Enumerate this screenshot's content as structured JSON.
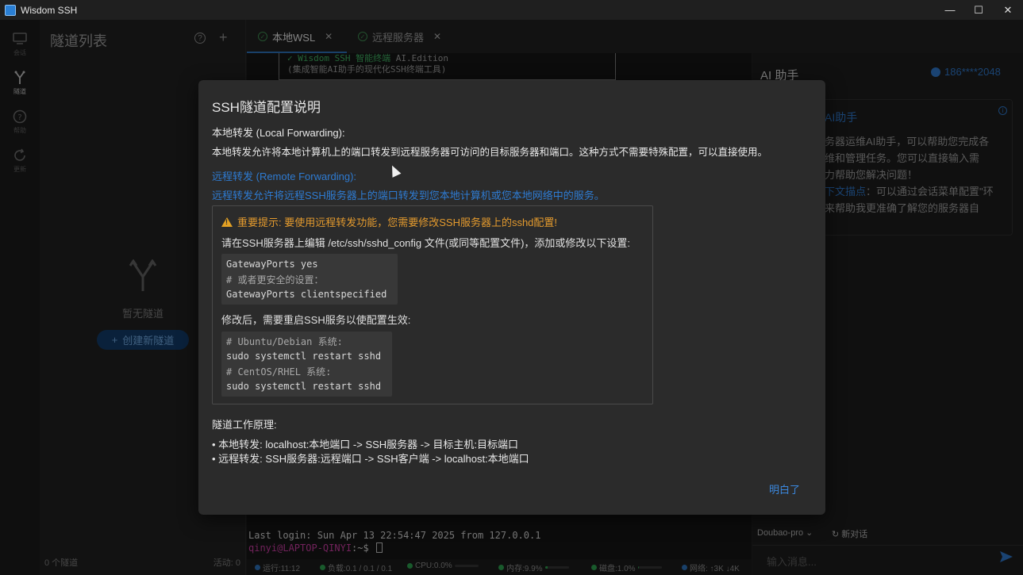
{
  "window": {
    "title": "Wisdom SSH",
    "minimize": "—",
    "maximize": "☐",
    "close": "✕"
  },
  "rail": {
    "items": [
      {
        "label": "会话",
        "icon": "monitor-icon"
      },
      {
        "label": "隧道",
        "icon": "fork-icon"
      },
      {
        "label": "帮助",
        "icon": "help-icon"
      },
      {
        "label": "更新",
        "icon": "refresh-icon"
      }
    ]
  },
  "tunnel_panel": {
    "title": "隧道列表",
    "help": "?",
    "add": "+",
    "empty_text": "暂无隧道",
    "create_button": "创建新隧道",
    "create_plus": "+",
    "count": "0 个隧道",
    "active": "活动: 0"
  },
  "tabs": [
    {
      "label": "本地WSL",
      "close": "✕",
      "active": true
    },
    {
      "label": "远程服务器",
      "close": "✕",
      "active": false
    }
  ],
  "terminal": {
    "banner_line1_prefix": "✓ Wisdom SSH 智能终端",
    "banner_line1_suffix": " AI.Edition",
    "banner_line2": "(集成智能AI助手的现代化SSH终端工具)",
    "last_login": "Last login: Sun Apr 13 22:54:47 2025 from 127.0.0.1",
    "prompt_user": "qinyi@LAPTOP-QINYI",
    "prompt_path": ":~$ "
  },
  "statusbar": {
    "runtime": "运行:11:12",
    "load": "负载:0.1 / 0.1 / 0.1",
    "cpu": "CPU:0.0%",
    "mem": "内存:9.9%",
    "disk": "磁盘:1.0%",
    "net": "网络: ↑3K ↓4K",
    "mem_level": 0.099,
    "disk_level": 0.01,
    "cpu_level": 0.0
  },
  "ai_panel": {
    "title": "AI 助手",
    "user": "186****2048",
    "card_heading": "AI助手",
    "card_line1": "务器运维AI助手，可以帮助您完成各",
    "card_line2": "维和管理任务。您可以直接输入需",
    "card_line3": "力帮助您解决问题！",
    "card_line4_hl": "下文描点",
    "card_line4_rest": "：可以通过会话菜单配置\"环",
    "card_line5": "来帮助我更准确了解您的服务器自",
    "model": "Doubao-pro",
    "new_chat": "新对话",
    "input_placeholder": "输入消息..."
  },
  "modal": {
    "title": "SSH隧道配置说明",
    "local_heading": "本地转发 (Local Forwarding):",
    "local_desc": "本地转发允许将本地计算机上的端口转发到远程服务器可访问的目标服务器和端口。这种方式不需要特殊配置，可以直接使用。",
    "remote_heading": "远程转发 (Remote Forwarding):",
    "remote_desc": "远程转发允许将远程SSH服务器上的端口转发到您本地计算机或您本地网络中的服务。",
    "warning": "重要提示: 要使用远程转发功能，您需要修改SSH服务器上的sshd配置!",
    "edit_instruction": "请在SSH服务器上编辑 /etc/ssh/sshd_config 文件(或同等配置文件)，添加或修改以下设置:",
    "code1_line1": "GatewayPorts yes",
    "code1_comment": "# 或者更安全的设置：",
    "code1_line3": "GatewayPorts clientspecified",
    "restart_instruction": "修改后，需要重启SSH服务以使配置生效:",
    "code2_comment1": "# Ubuntu/Debian 系统:",
    "code2_line1": "sudo systemctl restart sshd",
    "code2_comment2": "# CentOS/RHEL 系统:",
    "code2_line2": "sudo systemctl restart sshd",
    "principle_heading": "隧道工作原理:",
    "principle_local": "• 本地转发: localhost:本地端口 -> SSH服务器 -> 目标主机:目标端口",
    "principle_remote": "• 远程转发: SSH服务器:远程端口 -> SSH客户端 -> localhost:本地端口",
    "ok_button": "明白了"
  }
}
